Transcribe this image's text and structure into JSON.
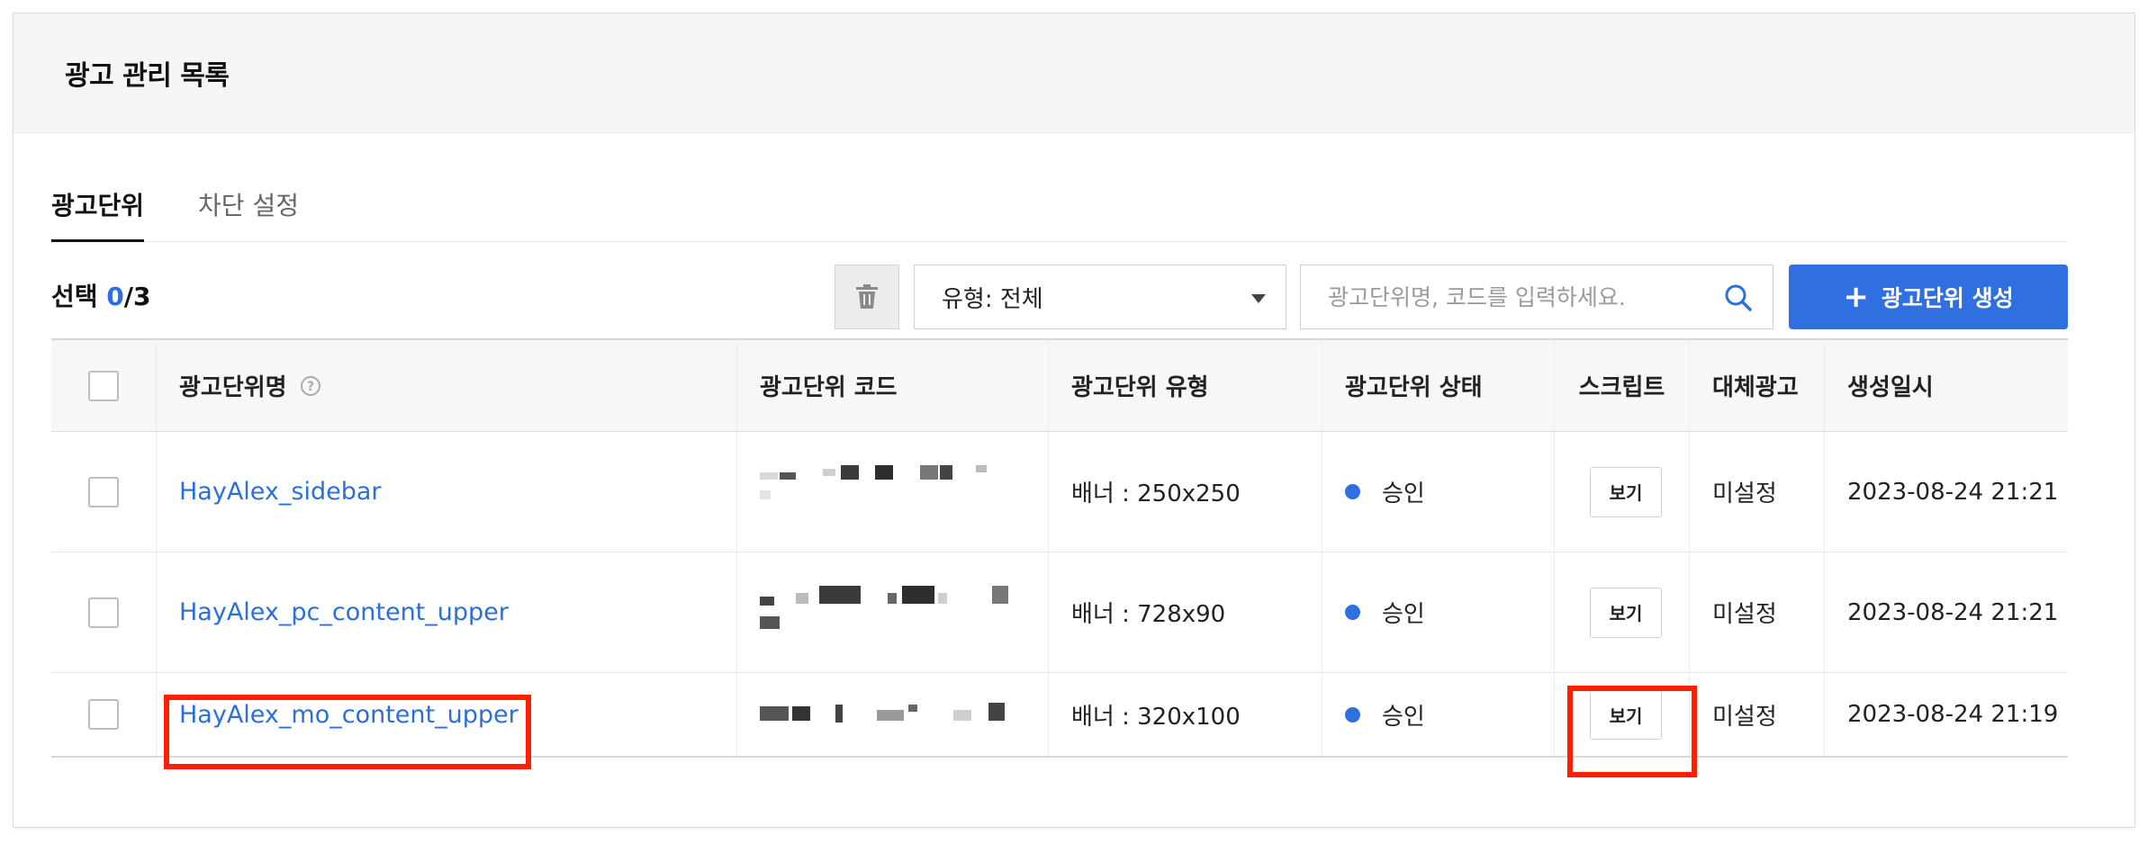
{
  "header": {
    "title": "광고 관리 목록"
  },
  "tabs": [
    {
      "label": "광고단위",
      "active": true
    },
    {
      "label": "차단 설정",
      "active": false
    }
  ],
  "toolbar": {
    "selection_prefix": "선택 ",
    "selected_count": "0",
    "selection_total": "/3",
    "type_filter": "유형: 전체",
    "search_placeholder": "광고단위명, 코드를 입력하세요.",
    "create_label": "광고단위 생성",
    "create_icon": "plus-icon",
    "delete_icon": "trash-icon",
    "search_icon": "search-icon"
  },
  "table": {
    "columns": [
      "광고단위명",
      "광고단위 코드",
      "광고단위 유형",
      "광고단위 상태",
      "스크립트",
      "대체광고",
      "생성일시"
    ],
    "rows": [
      {
        "name": "HayAlex_sidebar",
        "type": "배너 : 250x250",
        "status": "승인",
        "script": "보기",
        "fallback": "미설정",
        "created": "2023-08-24 21:21"
      },
      {
        "name": "HayAlex_pc_content_upper",
        "type": "배너 : 728x90",
        "status": "승인",
        "script": "보기",
        "fallback": "미설정",
        "created": "2023-08-24 21:21"
      },
      {
        "name": "HayAlex_mo_content_upper",
        "type": "배너 : 320x100",
        "status": "승인",
        "script": "보기",
        "fallback": "미설정",
        "created": "2023-08-24 21:19"
      }
    ]
  },
  "colors": {
    "accent": "#2f6fe0",
    "link": "#2a6fdb",
    "highlight": "#ff1f00"
  }
}
